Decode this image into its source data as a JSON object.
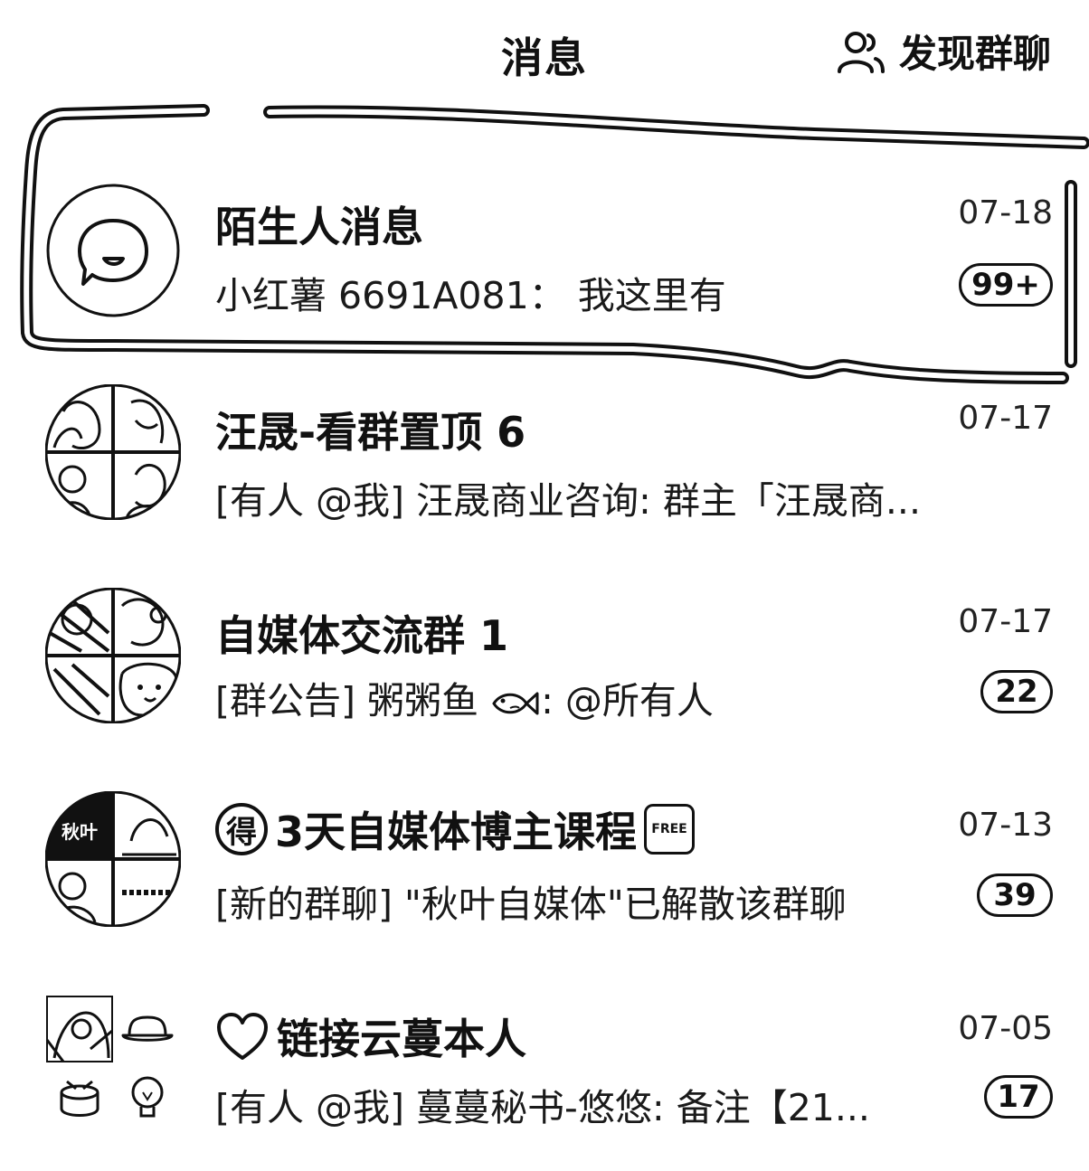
{
  "header": {
    "title": "消息",
    "discover_label": "发现群聊",
    "discover_icon": "users-icon"
  },
  "conversations": [
    {
      "title": "陌生人消息",
      "preview": "小红薯 6691A081： 我这里有",
      "time": "07-18",
      "badge": "99+",
      "avatar_icon": "chat-bubble-icon"
    },
    {
      "title": "汪晟-看群置顶 6",
      "preview": "[有人 @我] 汪晟商业咨询: 群主「汪晟商...",
      "time": "07-17",
      "badge": ""
    },
    {
      "title": "自媒体交流群 1",
      "preview_prefix": "[群公告] 粥粥鱼",
      "preview_suffix": ": @所有人",
      "time": "07-17",
      "badge": "22"
    },
    {
      "title": "3天自媒体博主课程",
      "title_prefix_icon": "得",
      "free_label": "FREE",
      "preview": "[新的群聊] \"秋叶自媒体\"已解散该群聊",
      "time": "07-13",
      "badge": "39",
      "avatar_text": "秋叶"
    },
    {
      "title": "链接云蔓本人",
      "preview": "[有人 @我] 蔓蔓秘书-悠悠: 备注【21...",
      "time": "07-05",
      "badge": "17"
    }
  ]
}
